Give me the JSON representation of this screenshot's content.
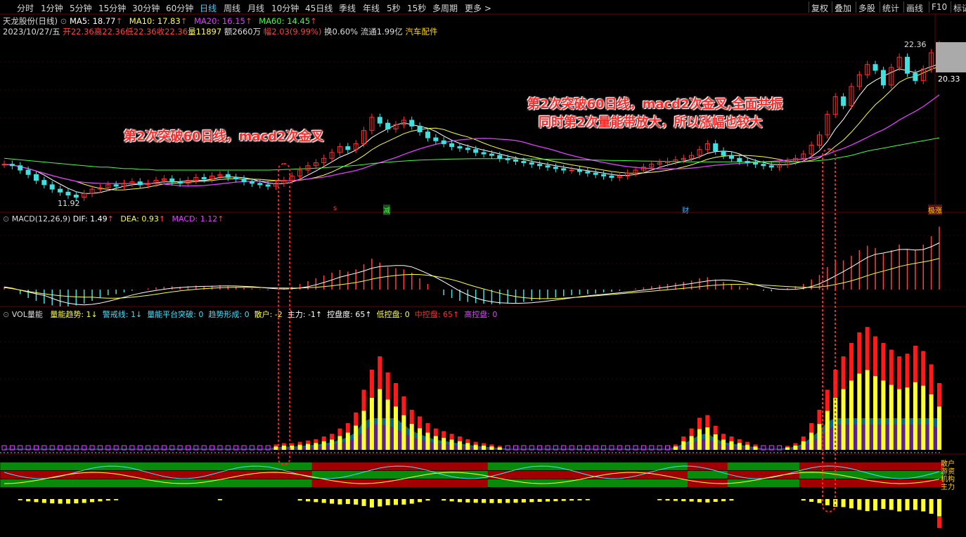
{
  "toolbar": {
    "periods": [
      "分时",
      "1分钟",
      "5分钟",
      "15分钟",
      "30分钟",
      "60分钟",
      "日线",
      "周线",
      "月线",
      "10分钟",
      "45日线",
      "季线",
      "年线",
      "5秒",
      "15秒",
      "多周期",
      "更多 >"
    ],
    "active_period": "日线",
    "right_buttons": [
      "复权",
      "叠加",
      "多股",
      "统计",
      "画线",
      "F10",
      "标记"
    ]
  },
  "stock": {
    "title": "天龙股份(日线)",
    "ma5": "MA5: 18.77",
    "ma10": "MA10: 17.83",
    "ma20": "MA20: 16.15",
    "ma60": "MA60: 14.45",
    "date": "2023/10/27/五",
    "open": "开22.36",
    "high": "高22.36",
    "low": "低22.36",
    "close": "收22.36",
    "volume": "量11897",
    "amount": "额2660万",
    "change": "幅2.03(9.99%)",
    "turnover": "换0.60%",
    "float": "流通1.99亿",
    "sector": "汽车配件"
  },
  "price_labels": {
    "high": "22.36",
    "mid": "20.33",
    "low": "11.92"
  },
  "markers": {
    "s": "s",
    "jian": "减",
    "cai": "财",
    "zhang": "极涨"
  },
  "macd_line": {
    "title": "MACD(12,26,9)",
    "dif": "DIF: 1.49",
    "dea": "DEA: 0.93",
    "macd": "MACD: 1.12"
  },
  "vol_line": {
    "title": "VOL量能",
    "items": [
      {
        "text": "量能趋势: 1↓",
        "color": "#ffff40"
      },
      {
        "text": "警戒线: 1↓",
        "color": "#40e0ff"
      },
      {
        "text": "量能平台突破: 0",
        "color": "#40e0ff"
      },
      {
        "text": "趋势形成: 0",
        "color": "#40e0ff"
      },
      {
        "text": "散户: -2",
        "color": "#ffff40"
      },
      {
        "text": "主力: -1↑",
        "color": "#ffffff"
      },
      {
        "text": "控盘度: 65↑",
        "color": "#ffffff"
      },
      {
        "text": "低控盘: 0",
        "color": "#ffff40"
      },
      {
        "text": "中控盘: 65↑",
        "color": "#ff3030"
      },
      {
        "text": "高控盘: 0",
        "color": "#e040ff"
      }
    ]
  },
  "side_labels": [
    "散户",
    "游资",
    "机构",
    "主力"
  ],
  "annotations": {
    "left": "第2次突破60日线，macd2次金叉",
    "right_line1": "第2次突破60日线，macd2次金叉,全面共振",
    "right_line2": "同时第2次量能带放大，所以涨幅也较大"
  },
  "chart_data": {
    "type": "candlestick",
    "title": "天龙股份(日线)",
    "ylim": [
      11.5,
      23
    ],
    "closes": [
      14.2,
      14.1,
      13.8,
      13.5,
      13.1,
      12.8,
      12.5,
      12.3,
      12.1,
      11.95,
      12.2,
      12.5,
      12.6,
      12.8,
      12.7,
      12.9,
      13.0,
      12.8,
      12.9,
      13.1,
      13.2,
      13.0,
      12.9,
      13.1,
      13.3,
      13.2,
      13.4,
      13.5,
      13.3,
      13.2,
      13.0,
      12.9,
      12.8,
      12.7,
      12.9,
      13.1,
      13.4,
      13.8,
      14.1,
      14.3,
      14.6,
      15.0,
      15.4,
      15.2,
      15.6,
      16.5,
      17.4,
      17.0,
      16.6,
      16.9,
      17.2,
      16.8,
      16.4,
      16.0,
      15.8,
      15.6,
      15.4,
      15.3,
      15.2,
      15.0,
      14.9,
      14.8,
      14.6,
      14.5,
      14.4,
      14.3,
      14.2,
      14.1,
      14.0,
      13.9,
      13.8,
      13.8,
      13.7,
      13.6,
      13.5,
      13.4,
      13.3,
      13.4,
      13.6,
      13.8,
      14.0,
      14.2,
      14.3,
      14.4,
      14.5,
      14.6,
      14.8,
      15.2,
      15.6,
      15.1,
      14.8,
      14.6,
      14.4,
      14.3,
      14.2,
      14.1,
      14.0,
      14.2,
      14.4,
      14.6,
      14.9,
      15.5,
      16.2,
      17.6,
      18.8,
      18.2,
      19.5,
      20.3,
      21.0,
      20.6,
      19.6,
      20.8,
      21.5,
      20.4,
      19.9,
      20.7,
      21.8,
      22.36
    ],
    "ma5_label": "MA5: 18.77",
    "ma10_label": "MA10: 17.83",
    "ma20_label": "MA20: 16.15",
    "ma60_label": "MA60: 14.45",
    "ma60": [
      14.6,
      14.55,
      14.5,
      14.45,
      14.4,
      14.35,
      14.3,
      14.25,
      14.2,
      14.15,
      14.1,
      14.05,
      14.0,
      14.0,
      13.95,
      13.9,
      13.9,
      13.85,
      13.85,
      13.8,
      13.8,
      13.8,
      13.8,
      13.8,
      13.8,
      13.8,
      13.8,
      13.8,
      13.8,
      13.8,
      13.8,
      13.8,
      13.8,
      13.8,
      13.82,
      13.84,
      13.86,
      13.88,
      13.9,
      13.93,
      13.96,
      14.0,
      14.04,
      14.08,
      14.12,
      14.18,
      14.25,
      14.3,
      14.34,
      14.38,
      14.42,
      14.45,
      14.48,
      14.5,
      14.52,
      14.54,
      14.55,
      14.56,
      14.57,
      14.58,
      14.58,
      14.58,
      14.58,
      14.58,
      14.58,
      14.57,
      14.56,
      14.55,
      14.54,
      14.53,
      14.52,
      14.51,
      14.5,
      14.49,
      14.48,
      14.47,
      14.46,
      14.45,
      14.44,
      14.43,
      14.42,
      14.41,
      14.4,
      14.39,
      14.38,
      14.37,
      14.36,
      14.36,
      14.36,
      14.36,
      14.36,
      14.36,
      14.36,
      14.36,
      14.36,
      14.36,
      14.36,
      14.36,
      14.36,
      14.37,
      14.38,
      14.4,
      14.45,
      14.5,
      14.6,
      14.7,
      14.8,
      14.95,
      15.1,
      15.2,
      15.3,
      15.4,
      15.5,
      15.6,
      15.7,
      15.8,
      15.9,
      16.0
    ],
    "macd": [
      0.05,
      0.0,
      -0.08,
      -0.15,
      -0.2,
      -0.25,
      -0.28,
      -0.3,
      -0.3,
      -0.28,
      -0.25,
      -0.2,
      -0.15,
      -0.1,
      -0.08,
      -0.05,
      -0.02,
      0.0,
      0.02,
      0.04,
      0.05,
      0.06,
      0.05,
      0.06,
      0.07,
      0.06,
      0.07,
      0.08,
      0.06,
      0.05,
      0.03,
      0.02,
      0.01,
      -0.01,
      0.0,
      0.02,
      0.05,
      0.1,
      0.15,
      0.2,
      0.25,
      0.3,
      0.35,
      0.32,
      0.36,
      0.45,
      0.55,
      0.48,
      0.4,
      0.38,
      0.36,
      0.3,
      0.2,
      0.1,
      0.0,
      -0.1,
      -0.15,
      -0.2,
      -0.22,
      -0.24,
      -0.25,
      -0.26,
      -0.26,
      -0.25,
      -0.24,
      -0.22,
      -0.2,
      -0.18,
      -0.16,
      -0.14,
      -0.12,
      -0.1,
      -0.09,
      -0.08,
      -0.07,
      -0.05,
      -0.04,
      -0.02,
      0.0,
      0.02,
      0.04,
      0.06,
      0.08,
      0.1,
      0.12,
      0.14,
      0.16,
      0.2,
      0.22,
      0.18,
      0.14,
      0.1,
      0.06,
      0.03,
      0.0,
      -0.02,
      -0.03,
      0.0,
      0.03,
      0.06,
      0.1,
      0.18,
      0.26,
      0.4,
      0.5,
      0.52,
      0.6,
      0.7,
      0.78,
      0.74,
      0.64,
      0.7,
      0.8,
      0.72,
      0.7,
      0.8,
      0.95,
      1.12
    ],
    "vol_top": [
      0.02,
      0.02,
      0.02,
      0.02,
      0.02,
      0.02,
      0.02,
      0.02,
      0.02,
      0.02,
      0.02,
      0.02,
      0.02,
      0.02,
      0.02,
      0.02,
      0.02,
      0.02,
      0.02,
      0.02,
      0.02,
      0.02,
      0.02,
      0.02,
      0.02,
      0.02,
      0.02,
      0.02,
      0.02,
      0.02,
      0.02,
      0.02,
      0.02,
      0.02,
      0.04,
      0.05,
      0.05,
      0.06,
      0.07,
      0.08,
      0.1,
      0.12,
      0.16,
      0.2,
      0.28,
      0.45,
      0.6,
      0.7,
      0.58,
      0.5,
      0.4,
      0.3,
      0.25,
      0.2,
      0.16,
      0.14,
      0.12,
      0.1,
      0.08,
      0.06,
      0.05,
      0.04,
      0.03,
      0.02,
      0.02,
      0.02,
      0.02,
      0.02,
      0.02,
      0.02,
      0.02,
      0.02,
      0.02,
      0.02,
      0.02,
      0.02,
      0.02,
      0.02,
      0.02,
      0.02,
      0.02,
      0.02,
      0.02,
      0.02,
      0.04,
      0.1,
      0.16,
      0.24,
      0.26,
      0.18,
      0.12,
      0.1,
      0.08,
      0.06,
      0.04,
      0.02,
      0.02,
      0.02,
      0.03,
      0.05,
      0.1,
      0.2,
      0.3,
      0.45,
      0.6,
      0.7,
      0.8,
      0.88,
      0.92,
      0.85,
      0.8,
      0.75,
      0.7,
      0.72,
      0.78,
      0.74,
      0.64,
      0.5
    ]
  }
}
